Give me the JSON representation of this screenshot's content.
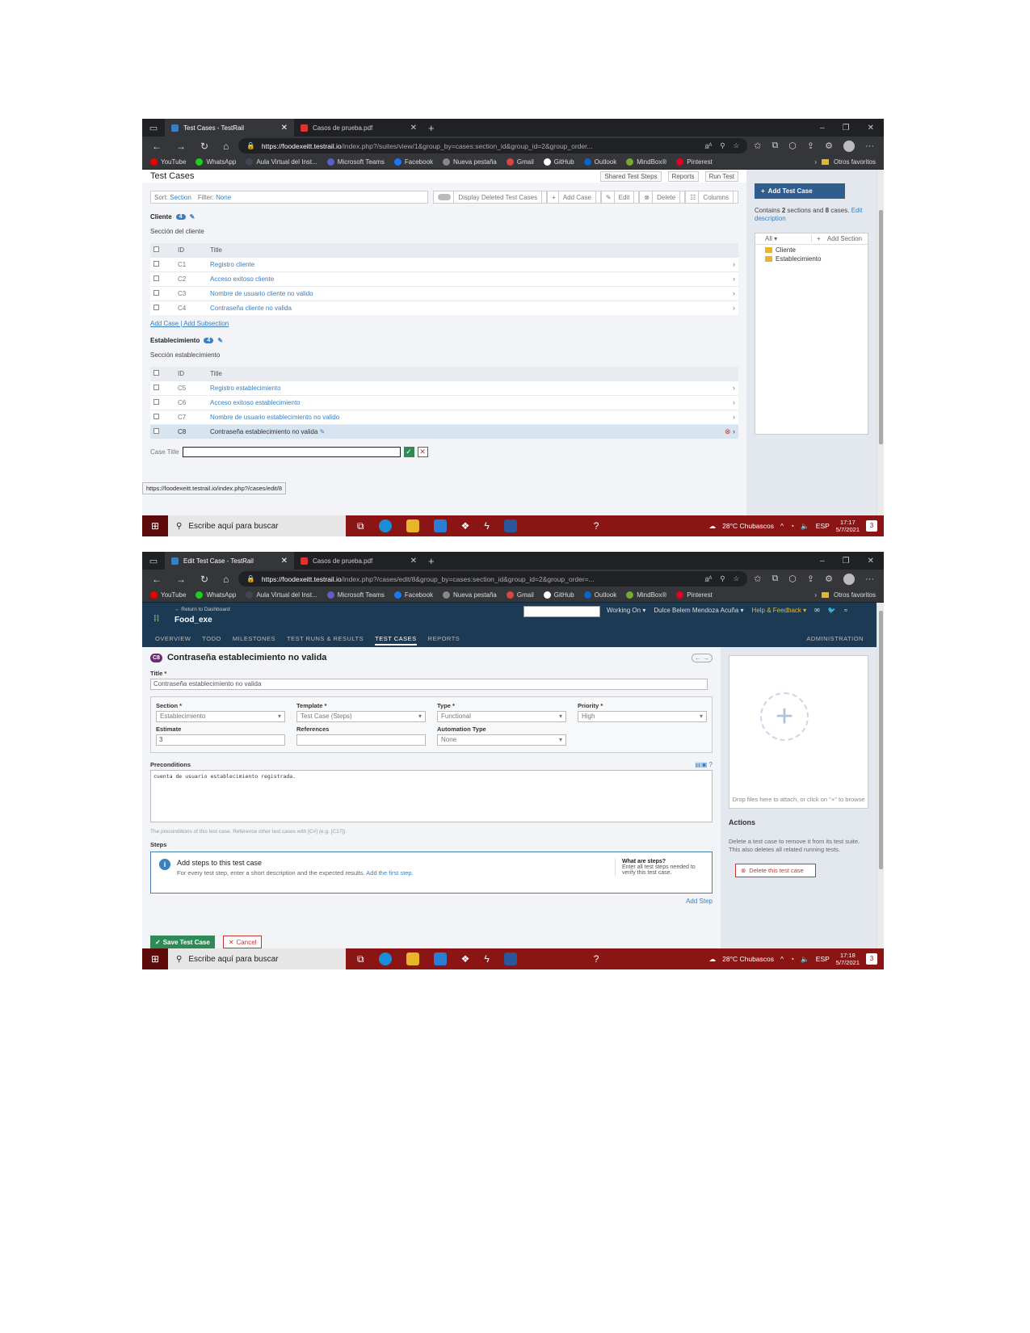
{
  "screen1": {
    "tabs": [
      {
        "label": "Test Cases - TestRail",
        "active": true
      },
      {
        "label": "Casos de prueba.pdf",
        "active": false
      }
    ],
    "url_host": "https://foodexeitt.testrail.io",
    "url_path": "/index.php?/suites/view/1&group_by=cases:section_id&group_id=2&group_order...",
    "page_title": "Test Cases",
    "toolbar": [
      "Shared Test Steps",
      "Reports",
      "Run Test"
    ],
    "sort_label": "Sort:",
    "sort_value": "Section",
    "filter_label": "Filter:",
    "filter_value": "None",
    "filter_buttons": {
      "display_deleted": "Display Deleted Test Cases",
      "add_case": "Add Case",
      "edit": "Edit",
      "delete": "Delete",
      "columns": "Columns"
    },
    "sections": [
      {
        "name": "Cliente",
        "count": "4",
        "description": "Sección del cliente",
        "cases": [
          {
            "id": "C1",
            "title": "Registro cliente"
          },
          {
            "id": "C2",
            "title": "Acceso exitoso cliente"
          },
          {
            "id": "C3",
            "title": "Nombre de usuario cliente no valido"
          },
          {
            "id": "C4",
            "title": "Contraseña cliente no valida"
          }
        ],
        "links": "Add Case | Add Subsection"
      },
      {
        "name": "Establecimiento",
        "count": "4",
        "description": "Sección establecimiento",
        "cases": [
          {
            "id": "C5",
            "title": "Registro establecimiento"
          },
          {
            "id": "C6",
            "title": "Acceso exitoso establecimiento"
          },
          {
            "id": "C7",
            "title": "Nombre de usuario establecimiento no valido"
          },
          {
            "id": "C8",
            "title": "Contraseña establecimiento no valida"
          }
        ]
      }
    ],
    "col_id": "ID",
    "col_title": "Title",
    "case_title_label": "Case Title",
    "status_url": "https://foodexeitt.testrail.io/index.php?/cases/edit/8",
    "add_test_case": "Add Test Case",
    "contains_pre": "Contains",
    "contains_sections": "2",
    "contains_mid": "sections and",
    "contains_cases": "8",
    "contains_cases_word": "cases.",
    "contains_link": "Edit description",
    "tree_all": "All",
    "tree_add_section": "Add Section",
    "tree_folders": [
      "Cliente",
      "Establecimiento"
    ],
    "clock_time": "17:17",
    "clock_date": "5/7/2021"
  },
  "screen2": {
    "tabs": [
      {
        "label": "Edit Test Case - TestRail",
        "active": true
      },
      {
        "label": "Casos de prueba.pdf",
        "active": false
      }
    ],
    "url_host": "https://foodexeitt.testrail.io",
    "url_path": "/index.php?/cases/edit/8&group_by=cases:section_id&group_id=2&group_order=...",
    "return_link": "← Return to Dashboard",
    "project": "Food_exe",
    "working_on": "Working On",
    "user_name": "Dulce Belem Mendoza Acuña",
    "help": "Help & Feedback",
    "nav": [
      "OVERVIEW",
      "TODO",
      "MILESTONES",
      "TEST RUNS & RESULTS",
      "TEST CASES",
      "REPORTS"
    ],
    "nav_admin": "ADMINISTRATION",
    "case_badge": "C8",
    "case_heading": "Contraseña establecimiento no valida",
    "title_label": "Title *",
    "title_value": "Contraseña establecimiento no valida",
    "fields": {
      "section_label": "Section *",
      "section_value": "Establecimiento",
      "template_label": "Template *",
      "template_value": "Test Case (Steps)",
      "type_label": "Type *",
      "type_value": "Functional",
      "priority_label": "Priority *",
      "priority_value": "High",
      "estimate_label": "Estimate",
      "estimate_value": "3",
      "references_label": "References",
      "automation_label": "Automation Type",
      "automation_value": "None"
    },
    "preconditions_label": "Preconditions",
    "preconditions_value": "cuenta de usuario establecimiento registrada.",
    "preconditions_hint": "The preconditions of this test case. Reference other test cases with [C#] (e.g. [C17]).",
    "steps_label": "Steps",
    "steps_title": "Add steps to this test case",
    "steps_desc": "For every test step, enter a short description and the expected results.",
    "steps_link": "Add the first step.",
    "what_title": "What are steps?",
    "what_desc": "Enter all test steps needed to verify this test case.",
    "add_step": "Add Step",
    "save": "Save Test Case",
    "cancel": "Cancel",
    "drop_text": "Drop files here to attach, or click on \"+\" to browse",
    "actions_title": "Actions",
    "actions_desc": "Delete a test case to remove it from its test suite. This also deletes all related running tests.",
    "delete_btn": "Delete this test case",
    "clock_time": "17:18",
    "clock_date": "5/7/2021"
  },
  "browser": {
    "bookmarks": [
      "YouTube",
      "WhatsApp",
      "Aula Virtual del Inst...",
      "Microsoft Teams",
      "Facebook",
      "Nueva pestaña",
      "Gmail",
      "GitHub",
      "Outlook",
      "MindBox®",
      "Pinterest"
    ],
    "other_favorites": "Otros favoritos"
  },
  "taskbar": {
    "search_placeholder": "Escribe aquí para buscar",
    "weather": "28°C  Chubascos",
    "lang": "ESP",
    "notif": "3"
  }
}
